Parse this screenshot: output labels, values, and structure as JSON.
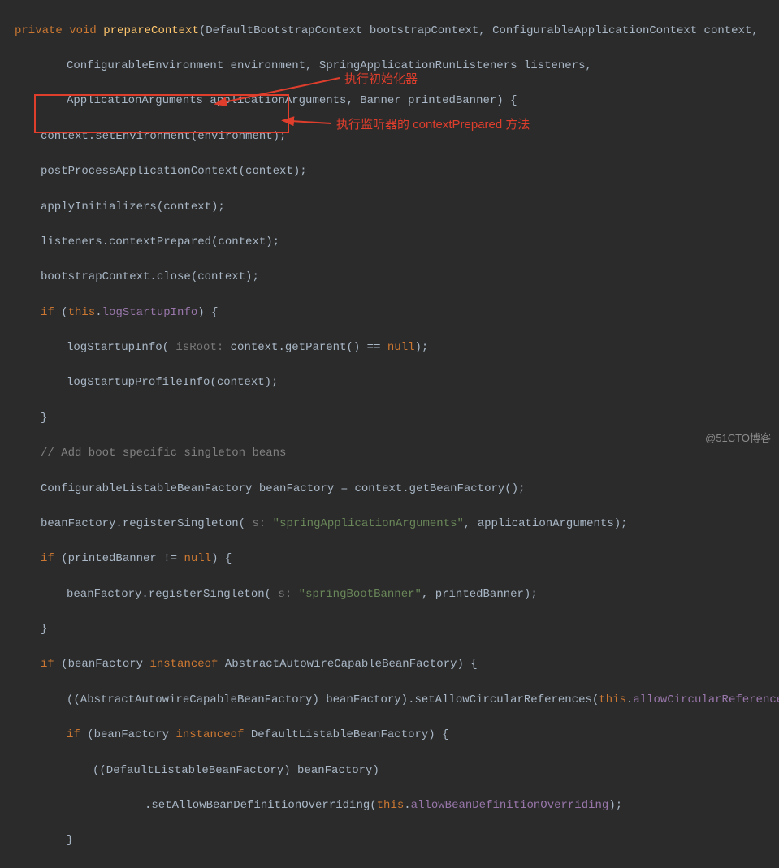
{
  "code": {
    "l1": {
      "kw1": "private",
      "kw2": "void",
      "fn": "prepareContext",
      "params1": "(DefaultBootstrapContext bootstrapContext, ConfigurableApplicationContext context,"
    },
    "l2": "ConfigurableEnvironment environment, SpringApplicationRunListeners listeners,",
    "l3": "ApplicationArguments applicationArguments, Banner printedBanner) {",
    "l4": "context.setEnvironment(environment);",
    "l5": "postProcessApplicationContext(context);",
    "l6": "applyInitializers(context);",
    "l7": "listeners.contextPrepared(context);",
    "l8": "bootstrapContext.close(context);",
    "l9": {
      "if": "if",
      "open": " (",
      "this": "this",
      "dot": ".",
      "fld": "logStartupInfo",
      "close": ") {"
    },
    "l10": {
      "call": "logStartupInfo(",
      "hint": " isRoot:",
      "rest": " context.getParent() == ",
      "null": "null",
      "end": ");"
    },
    "l11": "logStartupProfileInfo(context);",
    "l12": "}",
    "l13": "// Add boot specific singleton beans",
    "l14": "ConfigurableListableBeanFactory beanFactory = context.getBeanFactory();",
    "l15": {
      "a": "beanFactory.registerSingleton(",
      "hint": " s:",
      "str": " \"springApplicationArguments\"",
      "b": ", applicationArguments);"
    },
    "l16": {
      "if": "if",
      "a": " (printedBanner != ",
      "null": "null",
      "b": ") {"
    },
    "l17": {
      "a": "beanFactory.registerSingleton(",
      "hint": " s:",
      "str": " \"springBootBanner\"",
      "b": ", printedBanner);"
    },
    "l18": "}",
    "l19": {
      "if": "if",
      "a": " (beanFactory ",
      "inst": "instanceof",
      "b": " AbstractAutowireCapableBeanFactory) {"
    },
    "l20": {
      "a": "((AbstractAutowireCapableBeanFactory) beanFactory).setAllowCircularReferences(",
      "this": "this",
      "dot": ".",
      "fld": "allowCircularReferences",
      "b": ");"
    },
    "l21": {
      "if": "if",
      "a": " (beanFactory ",
      "inst": "instanceof",
      "b": " DefaultListableBeanFactory) {"
    },
    "l22": "((DefaultListableBeanFactory) beanFactory)",
    "l23": {
      "a": ".setAllowBeanDefinitionOverriding(",
      "this": "this",
      "dot": ".",
      "fld": "allowBeanDefinitionOverriding",
      "b": ");"
    },
    "l24": "}"
  },
  "annotations": {
    "top": "执行初始化器",
    "bottom": "执行监听器的 contextPrepared 方法"
  },
  "watermark": "@51CTO博客"
}
